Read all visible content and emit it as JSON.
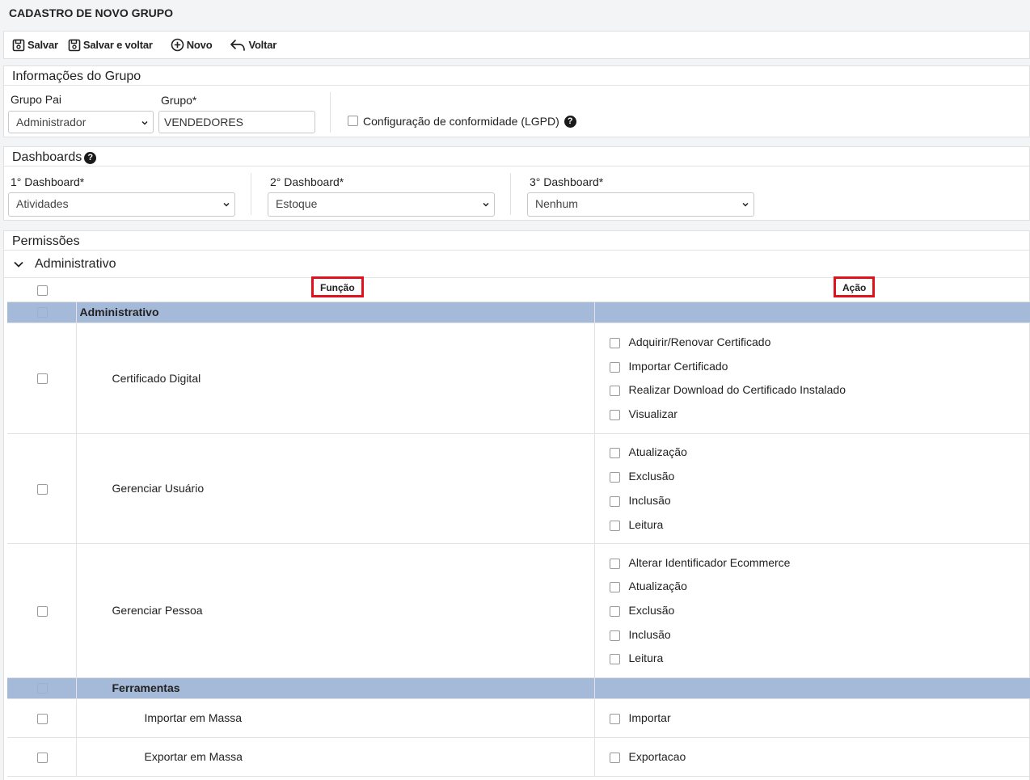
{
  "page": {
    "title": "CADASTRO DE NOVO GRUPO"
  },
  "toolbar": {
    "save_label": "Salvar",
    "save_back_label": "Salvar e voltar",
    "new_label": "Novo",
    "back_label": "Voltar"
  },
  "group_info": {
    "section_title": "Informações do Grupo",
    "parent_label": "Grupo Pai",
    "parent_value": "Administrador",
    "group_label": "Grupo*",
    "group_value": "VENDEDORES",
    "lgpd_label": "Configuração de conformidade (LGPD)"
  },
  "dashboards": {
    "section_title": "Dashboards",
    "d1_label": "1° Dashboard*",
    "d1_value": "Atividades",
    "d2_label": "2° Dashboard*",
    "d2_value": "Estoque",
    "d3_label": "3° Dashboard*",
    "d3_value": "Nenhum"
  },
  "permissions": {
    "section_title": "Permissões",
    "module_title": "Administrativo",
    "col_function": "Função",
    "col_action": "Ação",
    "group_admin": "Administrativo",
    "rows": [
      {
        "name": "Certificado Digital",
        "actions": [
          "Adquirir/Renovar Certificado",
          "Importar Certificado",
          "Realizar Download do Certificado Instalado",
          "Visualizar"
        ]
      },
      {
        "name": "Gerenciar Usuário",
        "actions": [
          "Atualização",
          "Exclusão",
          "Inclusão",
          "Leitura"
        ]
      },
      {
        "name": "Gerenciar Pessoa",
        "actions": [
          "Alterar Identificador Ecommerce",
          "Atualização",
          "Exclusão",
          "Inclusão",
          "Leitura"
        ]
      }
    ],
    "group_tools": "Ferramentas",
    "tools_rows": [
      {
        "name": "Importar em Massa",
        "actions": [
          "Importar"
        ]
      },
      {
        "name": "Exportar em Massa",
        "actions": [
          "Exportacao"
        ]
      }
    ]
  }
}
